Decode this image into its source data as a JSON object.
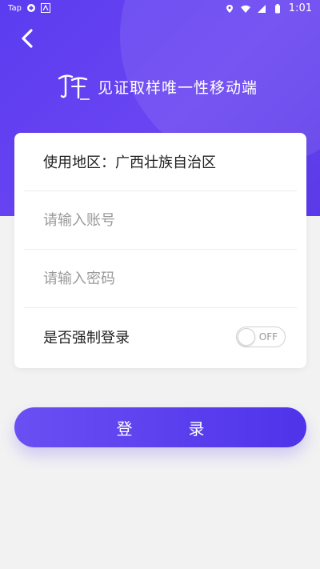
{
  "status_bar": {
    "carrier_label": "Tap",
    "time": "1:01"
  },
  "header": {
    "title": "见证取样唯一性移动端"
  },
  "form": {
    "region_label": "使用地区：",
    "region_value": "广西壮族自治区",
    "account_placeholder": "请输入账号",
    "password_placeholder": "请输入密码",
    "force_login_label": "是否强制登录",
    "toggle_state_text": "OFF",
    "force_login_enabled": false
  },
  "actions": {
    "login_label": "登录"
  },
  "colors": {
    "primary": "#5b3cf0",
    "background": "#f2f2f2",
    "card": "#ffffff"
  }
}
